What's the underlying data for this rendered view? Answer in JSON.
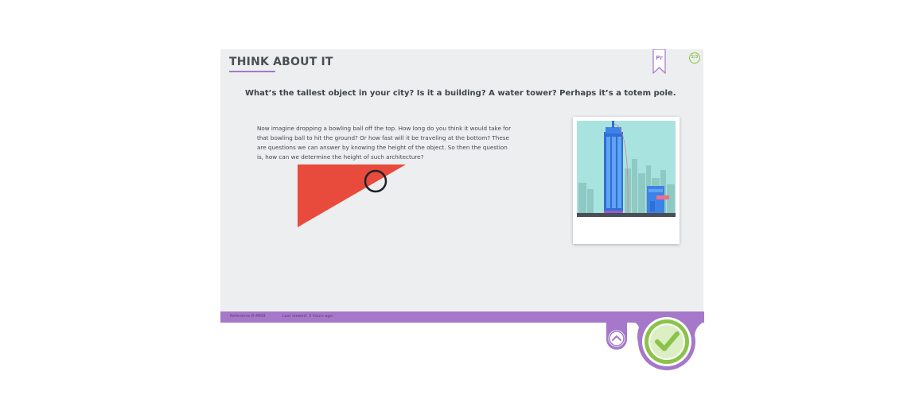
{
  "lesson": {
    "title": "THINK ABOUT IT",
    "bookmark_label": "Pr",
    "page_badge": "2/3",
    "question": "What’s the tallest object in your city? Is it a building? A water tower? Perhaps it’s a totem pole.",
    "body": "Now imagine dropping a bowling ball off the top. How long do you think it would take for that bowling ball to hit the ground? Or how fast will it be traveling at the bottom? These are questions we can answer by knowing the height of the object. So then the question is, how can we determine the height of such architecture?"
  },
  "footer": {
    "reference": "Reference R-4909",
    "last_viewed": "Last viewed: 3 hours ago"
  },
  "colors": {
    "accent_purple": "#a678c9",
    "check_green": "#8bc34a",
    "pointer_red": "#e84b3c",
    "card_bg": "#eceeef"
  },
  "icons": {
    "bookmark": "bookmark-icon",
    "nav_up": "chevron-up-icon",
    "complete": "checkmark-icon"
  }
}
